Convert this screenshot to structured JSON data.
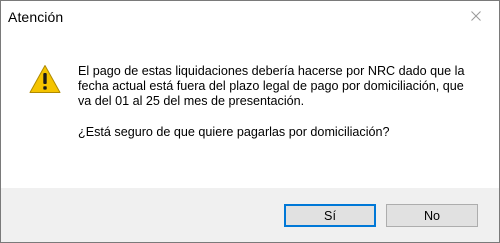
{
  "window": {
    "title": "Atención"
  },
  "icons": {
    "close": "close-icon",
    "warning": "warning-icon"
  },
  "message": {
    "body": "El pago de estas liquidaciones debería hacerse por NRC dado que la fecha actual está fuera del plazo legal de pago por domiciliación, que va del 01 al 25 del mes de presentación.",
    "question": "¿Está seguro de que quiere pagarlas por domiciliación?"
  },
  "buttons": {
    "yes_label": "Sí",
    "no_label": "No"
  },
  "colors": {
    "warning_fill": "#f5c400",
    "default_button_border": "#0078d7",
    "footer_background": "#f0f0f0"
  }
}
